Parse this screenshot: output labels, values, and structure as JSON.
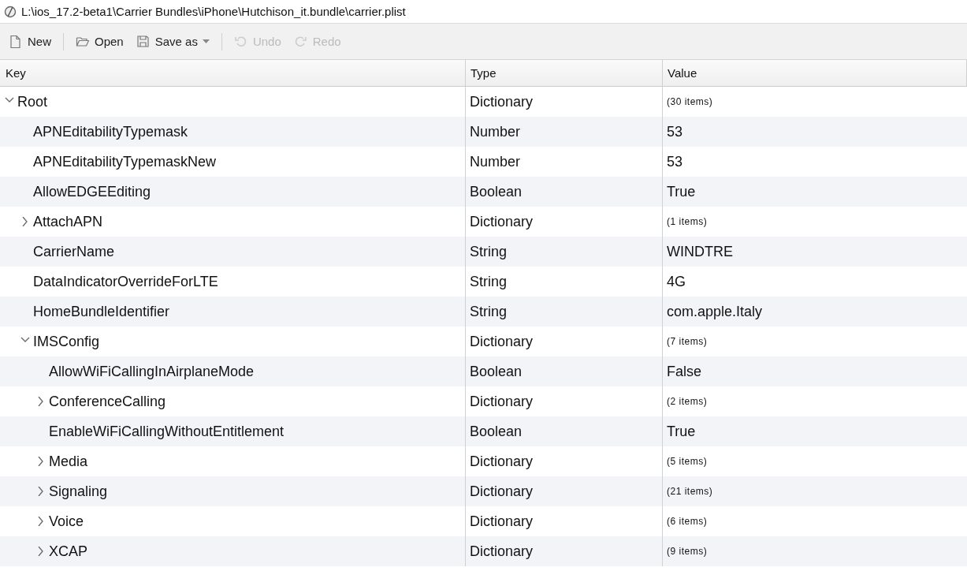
{
  "window": {
    "title": "L:\\ios_17.2-beta1\\Carrier Bundles\\iPhone\\Hutchison_it.bundle\\carrier.plist"
  },
  "toolbar": [
    {
      "kind": "new",
      "label": "New",
      "disabled": false
    },
    {
      "kind": "open",
      "label": "Open",
      "disabled": false
    },
    {
      "kind": "save",
      "label": "Save as",
      "disabled": false
    },
    {
      "kind": "undo",
      "label": "Undo",
      "disabled": true
    },
    {
      "kind": "redo",
      "label": "Redo",
      "disabled": true
    }
  ],
  "table": {
    "columns": [
      "Key",
      "Type",
      "Value"
    ],
    "rows": [
      {
        "key": "Root",
        "type": "Dictionary",
        "value": "(30 items)",
        "kind": "branch",
        "expanded": true,
        "children": [
          {
            "key": "APNEditabilityTypemask",
            "type": "Number",
            "value": "53",
            "kind": "leaf"
          },
          {
            "key": "APNEditabilityTypemaskNew",
            "type": "Number",
            "value": "53",
            "kind": "leaf"
          },
          {
            "key": "AllowEDGEEditing",
            "type": "Boolean",
            "value": "True",
            "kind": "leaf"
          },
          {
            "key": "AttachAPN",
            "type": "Dictionary",
            "value": "(1 items)",
            "kind": "branch",
            "expanded": false
          },
          {
            "key": "CarrierName",
            "type": "String",
            "value": "WINDTRE",
            "kind": "leaf"
          },
          {
            "key": "DataIndicatorOverrideForLTE",
            "type": "String",
            "value": "4G",
            "kind": "leaf"
          },
          {
            "key": "HomeBundleIdentifier",
            "type": "String",
            "value": "com.apple.Italy",
            "kind": "leaf"
          },
          {
            "key": "IMSConfig",
            "type": "Dictionary",
            "value": "(7 items)",
            "kind": "branch",
            "expanded": true,
            "children": [
              {
                "key": "AllowWiFiCallingInAirplaneMode",
                "type": "Boolean",
                "value": "False",
                "kind": "leaf"
              },
              {
                "key": "ConferenceCalling",
                "type": "Dictionary",
                "value": "(2 items)",
                "kind": "branch",
                "expanded": false
              },
              {
                "key": "EnableWiFiCallingWithoutEntitlement",
                "type": "Boolean",
                "value": "True",
                "kind": "leaf"
              },
              {
                "key": "Media",
                "type": "Dictionary",
                "value": "(5 items)",
                "kind": "branch",
                "expanded": false
              },
              {
                "key": "Signaling",
                "type": "Dictionary",
                "value": "(21 items)",
                "kind": "branch",
                "expanded": false
              },
              {
                "key": "Voice",
                "type": "Dictionary",
                "value": "(6 items)",
                "kind": "branch",
                "expanded": false
              },
              {
                "key": "XCAP",
                "type": "Dictionary",
                "value": "(9 items)",
                "kind": "branch",
                "expanded": false
              }
            ]
          }
        ]
      }
    ]
  }
}
